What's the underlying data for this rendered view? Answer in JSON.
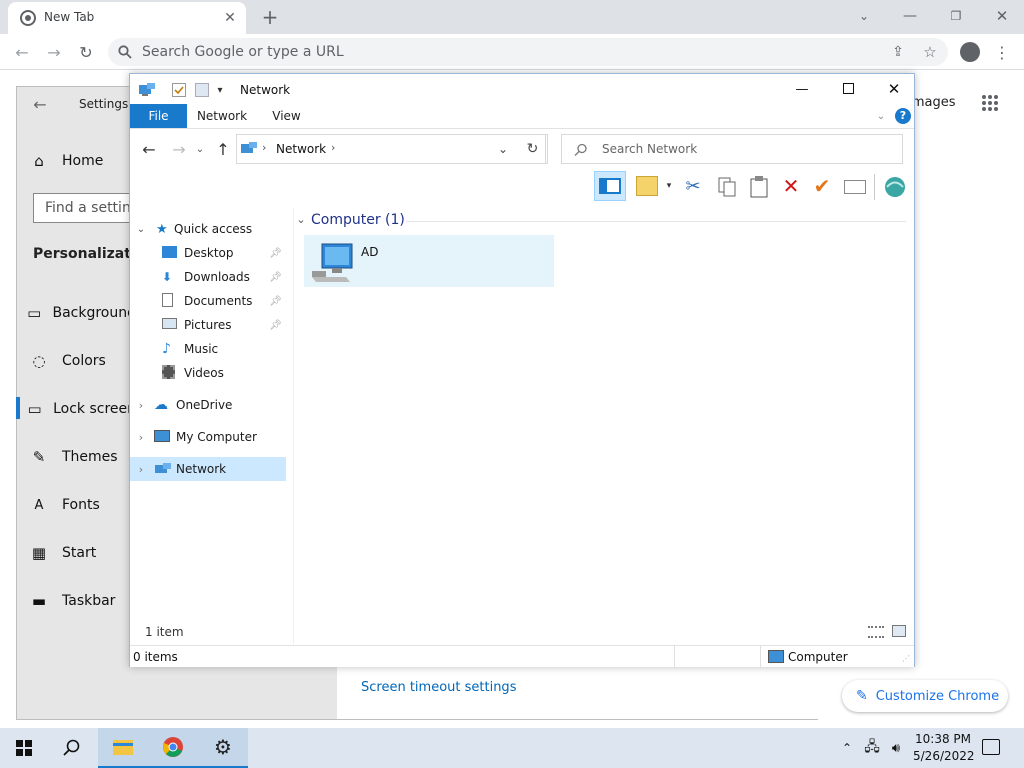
{
  "chrome": {
    "tab_title": "New Tab",
    "omnibox_placeholder": "Search Google or type a URL",
    "images_link": "Images",
    "customize_label": "Customize Chrome"
  },
  "settings": {
    "title": "Settings",
    "home": "Home",
    "search_placeholder": "Find a setting",
    "section": "Personalization",
    "nav": [
      {
        "label": "Background",
        "icon": "image-icon"
      },
      {
        "label": "Colors",
        "icon": "palette-icon"
      },
      {
        "label": "Lock screen",
        "icon": "lock-screen-icon"
      },
      {
        "label": "Themes",
        "icon": "themes-icon"
      },
      {
        "label": "Fonts",
        "icon": "fonts-icon"
      },
      {
        "label": "Start",
        "icon": "start-icon"
      },
      {
        "label": "Taskbar",
        "icon": "taskbar-icon"
      }
    ],
    "screen_timeout_link": "Screen timeout settings"
  },
  "explorer": {
    "title": "Network",
    "tabs": {
      "file": "File",
      "network": "Network",
      "view": "View"
    },
    "address_crumb": "Network",
    "search_placeholder": "Search Network",
    "group_header": "Computer (1)",
    "items": [
      {
        "name": "AD"
      }
    ],
    "nav": {
      "quick_access": "Quick access",
      "desktop": "Desktop",
      "downloads": "Downloads",
      "documents": "Documents",
      "pictures": "Pictures",
      "music": "Music",
      "videos": "Videos",
      "onedrive": "OneDrive",
      "my_computer": "My Computer",
      "network": "Network"
    },
    "item_count": "1 item",
    "status_items": "0 items",
    "status_zone": "Computer"
  },
  "taskbar": {
    "time": "10:38 PM",
    "date": "5/26/2022"
  },
  "colors": {
    "accent": "#1979ca",
    "selection": "#cce8ff"
  }
}
